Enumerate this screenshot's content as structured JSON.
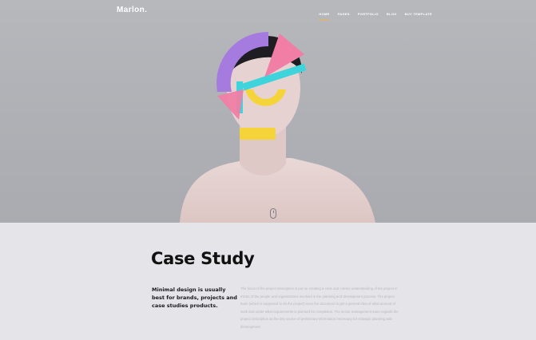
{
  "header": {
    "brand": "Marlon.",
    "nav": [
      "HOME",
      "PAGES",
      "PORTFOLIO",
      "BLOG",
      "BUY TEMPLATE"
    ]
  },
  "colors": {
    "hero_bg": "#b0b1b6",
    "section_bg": "#e5e4e9",
    "accent_purple": "#a57be0",
    "accent_pink": "#f07ea5",
    "accent_cyan": "#3fd3dc",
    "accent_yellow": "#f5d43a",
    "nav_active_underline": "#e9b24a"
  },
  "hero": {
    "icons": [
      "scroll-down-mouse-icon"
    ]
  },
  "section": {
    "title": "Case Study",
    "tagline": "Minimal design is usually best for brands, projects and case studies products.",
    "description": "The focus of the project description is put on creating a clear and correct understanding of the project in minds of the people and organizations involved in the planning and development process. The project team (which is supposed to do the project) uses the document to get a general idea of what amount of work and under what requirements is planned for completion. The senior management team regards the project description as the key source of preliminary information necessary for strategic planning and development."
  }
}
